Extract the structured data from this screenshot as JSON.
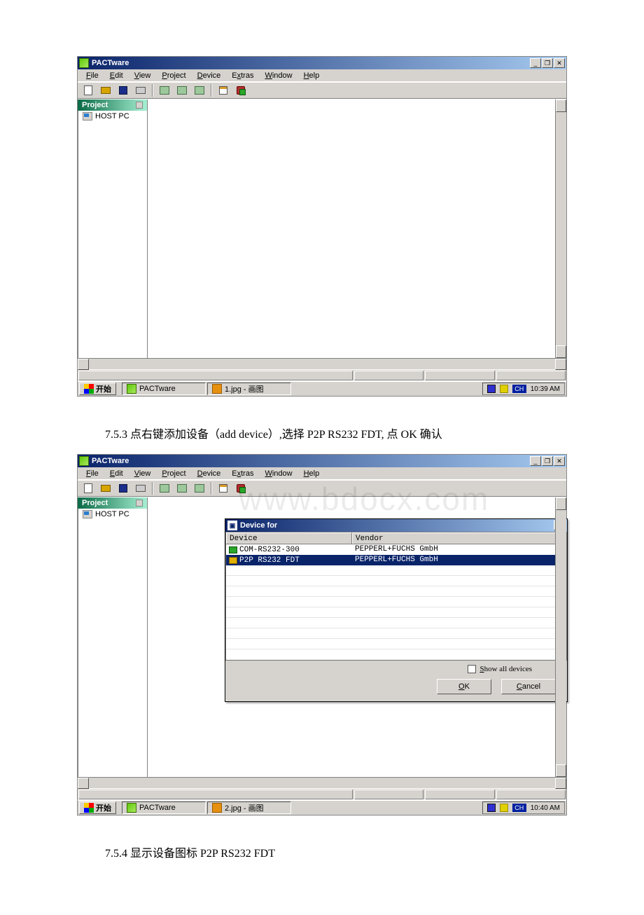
{
  "shot1": {
    "title": "PACTware",
    "menus": [
      {
        "u": "F",
        "rest": "ile"
      },
      {
        "u": "E",
        "rest": "dit"
      },
      {
        "u": "V",
        "rest": "iew"
      },
      {
        "u": "P",
        "rest": "roject"
      },
      {
        "u": "D",
        "rest": "evice"
      },
      {
        "ux": "E",
        "pre": "E",
        "ut": "x",
        "rest": "tras"
      },
      {
        "u": "W",
        "rest": "indow"
      },
      {
        "u": "H",
        "rest": "elp"
      }
    ],
    "sidebar_title": "Project",
    "tree_item": "HOST PC",
    "task_start": "开始",
    "task_app": "PACTware",
    "task_paint": "1.jpg - 画图",
    "ime": "CH",
    "clock": "10:39 AM"
  },
  "doc753": "7.5.3 点右键添加设备（add device）,选择 P2P RS232 FDT, 点 OK 确认",
  "shot2": {
    "title": "PACTware",
    "menus": [
      {
        "u": "F",
        "rest": "ile"
      },
      {
        "u": "E",
        "rest": "dit"
      },
      {
        "u": "V",
        "rest": "iew"
      },
      {
        "u": "P",
        "rest": "roject"
      },
      {
        "u": "D",
        "rest": "evice"
      },
      {
        "pre": "E",
        "ut": "x",
        "rest": "tras"
      },
      {
        "u": "W",
        "rest": "indow"
      },
      {
        "u": "H",
        "rest": "elp"
      }
    ],
    "sidebar_title": "Project",
    "tree_item": "HOST PC",
    "watermark": "www.bdocx.com",
    "dialog": {
      "title": "Device for",
      "col_device": "Device",
      "col_vendor": "Vendor",
      "rows": [
        {
          "dev": "COM-RS232-300",
          "ven": "PEPPERL+FUCHS GmbH"
        },
        {
          "dev": "P2P RS232 FDT",
          "ven": "PEPPERL+FUCHS GmbH"
        }
      ],
      "show_all": "Show all devices",
      "ok": "OK",
      "cancel": "Cancel"
    },
    "task_start": "开始",
    "task_app": "PACTware",
    "task_paint": "2.jpg - 画图",
    "ime": "CH",
    "clock": "10:40 AM"
  },
  "doc754": "7.5.4 显示设备图标 P2P RS232 FDT"
}
